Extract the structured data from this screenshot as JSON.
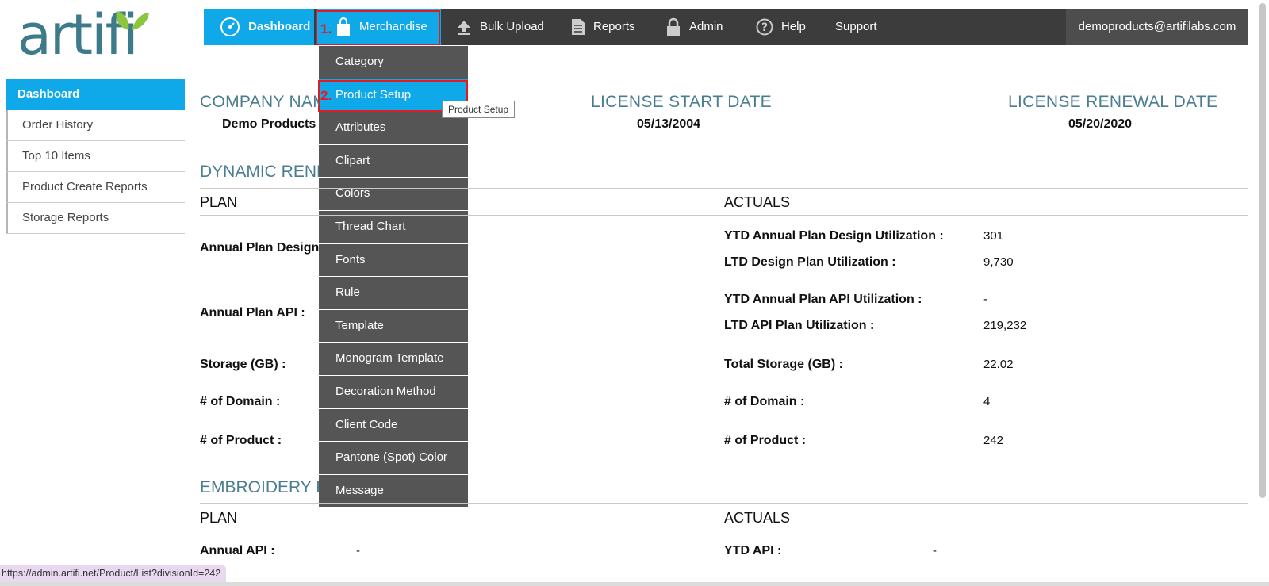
{
  "logo": {
    "text": "artifi"
  },
  "sidebar": {
    "active": "Dashboard",
    "items": [
      "Order History",
      "Top 10 Items",
      "Product Create Reports",
      "Storage Reports"
    ]
  },
  "nav": {
    "dashboard": "Dashboard",
    "merchandise": "Merchandise",
    "bulk_upload": "Bulk Upload",
    "reports": "Reports",
    "admin": "Admin",
    "help": "Help",
    "support": "Support",
    "email": "demoproducts@artifilabs.com"
  },
  "annotations": {
    "step1": "1.",
    "step2": "2."
  },
  "dropdown": {
    "items": [
      "Category",
      "Product Setup",
      "Attributes",
      "Clipart",
      "Colors",
      "Thread Chart",
      "Fonts",
      "Rule",
      "Template",
      "Monogram Template",
      "Decoration Method",
      "Client Code",
      "Pantone (Spot) Color",
      "Message"
    ],
    "tooltip": "Product Setup"
  },
  "company": {
    "name_label": "COMPANY NAME",
    "name_value": "Demo Products",
    "start_label": "LICENSE START DATE",
    "start_value": "05/13/2004",
    "renewal_label": "LICENSE RENEWAL DATE",
    "renewal_value": "05/20/2020"
  },
  "dynamic": {
    "title": "DYNAMIC RENDERING",
    "plan_header": "PLAN",
    "actuals_header": "ACTUALS",
    "plan_labels": [
      "Annual Plan Design :",
      "Annual Plan API :",
      "Storage (GB) :",
      "# of Domain :",
      "# of Product :"
    ],
    "actuals": [
      {
        "label": "YTD Annual Plan Design Utilization :",
        "value": "301"
      },
      {
        "label": "LTD Design Plan Utilization :",
        "value": "9,730"
      },
      {
        "label": "YTD Annual Plan API Utilization :",
        "value": "-"
      },
      {
        "label": "LTD API Plan Utilization :",
        "value": "219,232"
      },
      {
        "label": "Total Storage (GB) :",
        "value": "22.02"
      },
      {
        "label": "# of Domain :",
        "value": "4"
      },
      {
        "label": "# of Product :",
        "value": "242"
      }
    ]
  },
  "embroidery": {
    "title": "EMBROIDERY RENDERING",
    "plan_header": "PLAN",
    "actuals_header": "ACTUALS",
    "plan_label": "Annual API :",
    "plan_value": "-",
    "actual_label": "YTD API :",
    "actual_value": "-"
  },
  "status_url": "https://admin.artifi.net/Product/List?divisionId=242",
  "colors": {
    "accent": "#0fa8e8",
    "nav_bg": "#3c3c3c",
    "menu_bg": "#555555",
    "heading": "#4a7d8f",
    "highlight": "#e01b24"
  }
}
